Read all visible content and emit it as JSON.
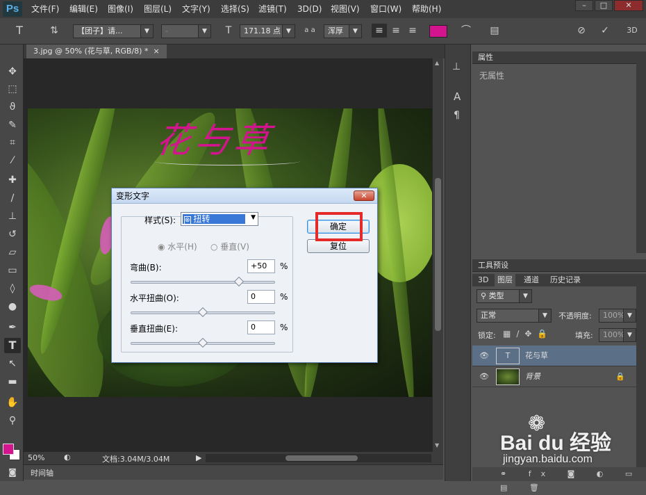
{
  "app": {
    "logo": "Ps"
  },
  "menu": [
    "文件(F)",
    "编辑(E)",
    "图像(I)",
    "图层(L)",
    "文字(Y)",
    "选择(S)",
    "滤镜(T)",
    "3D(D)",
    "视图(V)",
    "窗口(W)",
    "帮助(H)"
  ],
  "window_controls": [
    "–",
    "□",
    "✕"
  ],
  "options": {
    "font_family": "【团子】请...",
    "font_size": "171.18 点",
    "aa_label": "a a",
    "aa_mode": "浑厚",
    "text_color": "#d4148e",
    "threed_label": "3D"
  },
  "document": {
    "tab_title": "3.jpg @ 50% (花与草, RGB/8) *",
    "canvas_text": "花与草"
  },
  "status": {
    "zoom": "50%",
    "doc_size": "文档:3.04M/3.04M"
  },
  "timeline_label": "时间轴",
  "panels": {
    "properties": {
      "title": "属性",
      "content": "无属性"
    },
    "tool_presets": {
      "title": "工具预设"
    },
    "layers_tabs": [
      "3D",
      "图层",
      "通道",
      "历史记录"
    ],
    "filter_kind": "类型",
    "blend_mode": "正常",
    "opacity_label": "不透明度:",
    "opacity_value": "100%",
    "lock_label": "锁定:",
    "fill_label": "填充:",
    "fill_value": "100%",
    "layers": [
      {
        "name": "花与草",
        "type": "text",
        "selected": true
      },
      {
        "name": "背景",
        "type": "image",
        "locked": true
      }
    ]
  },
  "dialog": {
    "title": "变形文字",
    "style_label": "样式(S):",
    "style_value": "扭转",
    "horizontal": "水平(H)",
    "vertical": "垂直(V)",
    "bend_label": "弯曲(B):",
    "bend_value": "+50",
    "bend_fraction": 0.75,
    "hdistort_label": "水平扭曲(O):",
    "hdistort_value": "0",
    "vdistort_label": "垂直扭曲(E):",
    "vdistort_value": "0",
    "percent": "%",
    "ok": "确定",
    "reset": "复位"
  },
  "watermark": {
    "brand": "Bai du 经验",
    "url": "jingyan.baidu.com"
  },
  "colors": {
    "foreground": "#d4148e",
    "background": "#ffffff",
    "highlight": "#e52a2a",
    "selected_layer": "#5b6f86"
  }
}
